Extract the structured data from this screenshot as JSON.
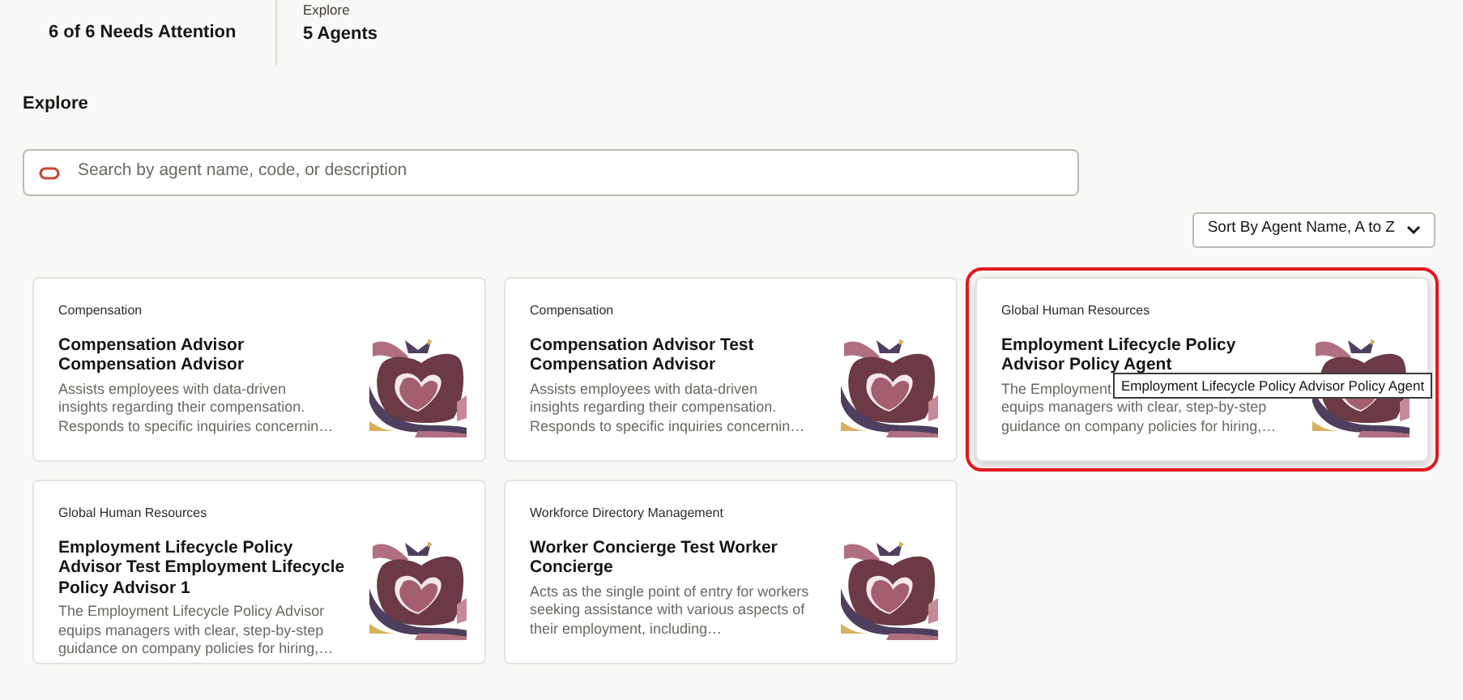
{
  "summary": [
    {
      "value": "6 of 6 Needs Attention"
    },
    {
      "label": "Explore",
      "value": "5 Agents"
    }
  ],
  "section_title": "Explore",
  "search": {
    "placeholder": "Search by agent name, code, or description"
  },
  "sort": {
    "label": "Sort By",
    "value": "Agent Name, A to Z"
  },
  "cards": [
    {
      "category": "Compensation",
      "title": "Compensation Advisor Compensation Advisor",
      "lines": [
        "Assists employees with data-driven",
        "insights regarding their compensation.",
        "Responds to specific inquiries concernin…"
      ],
      "highlighted": false
    },
    {
      "category": "Compensation",
      "title": "Compensation Advisor Test Compensation Advisor",
      "lines": [
        "Assists employees with data-driven",
        "insights regarding their compensation.",
        "Responds to specific inquiries concernin…"
      ],
      "highlighted": false
    },
    {
      "category": "Global Human Resources",
      "title": "Employment Lifecycle Policy Advisor Policy Agent",
      "lines": [
        "The Employment",
        "equips managers with clear, step-by-step",
        "guidance on company policies for hiring,…"
      ],
      "highlighted": true,
      "tooltip": "Employment Lifecycle Policy Advisor Policy Agent"
    },
    {
      "category": "Global Human Resources",
      "title": "Employment Lifecycle Policy Advisor Test Employment Lifecycle Policy Advisor 1",
      "lines": [
        "The Employment Lifecycle Policy Advisor",
        "equips managers with clear, step-by-step",
        "guidance on company policies for hiring,…"
      ],
      "highlighted": false
    },
    {
      "category": "Workforce Directory Management",
      "title": "Worker Concierge Test Worker Concierge",
      "lines": [
        "Acts as the single point of entry for workers",
        "seeking assistance with various aspects of",
        "their employment, including…"
      ],
      "highlighted": false
    }
  ]
}
